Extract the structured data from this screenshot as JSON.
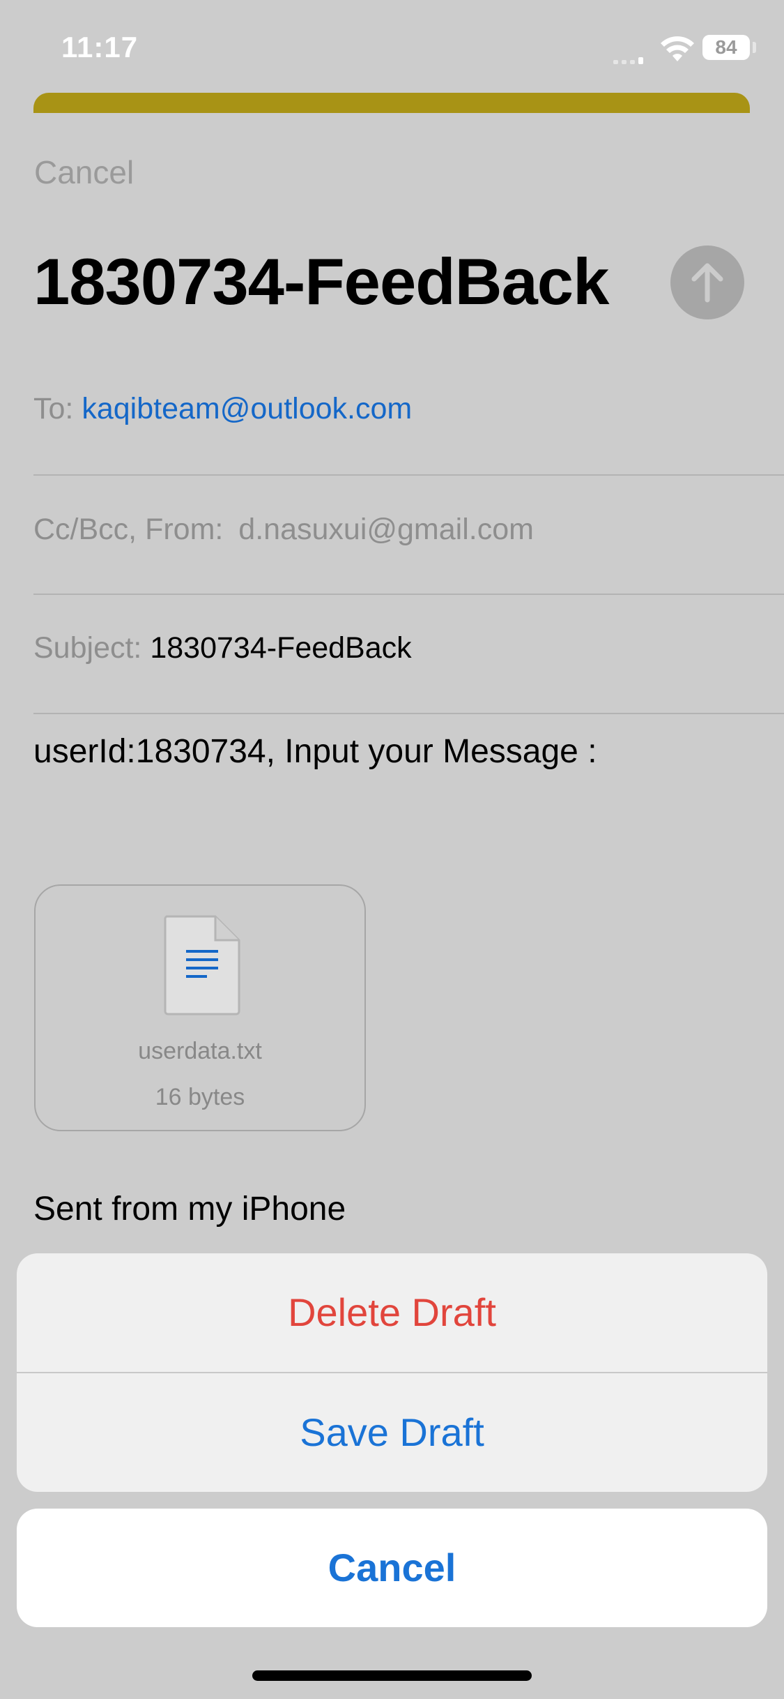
{
  "status_bar": {
    "time": "11:17",
    "battery": "84",
    "icons": [
      "signal-icon",
      "wifi-icon",
      "battery-icon"
    ]
  },
  "compose": {
    "cancel_label": "Cancel",
    "title": "1830734-FeedBack",
    "send_icon": "arrow-up-icon",
    "to_label": "To:",
    "to_value": "kaqibteam@outlook.com",
    "cc_label": "Cc/Bcc, From:",
    "from_value": "d.nasuxui@gmail.com",
    "subject_label": "Subject:",
    "subject_value": "1830734-FeedBack",
    "body": "userId:1830734, Input your Message :",
    "attachment": {
      "icon": "text-document-icon",
      "name": "userdata.txt",
      "size": "16 bytes"
    },
    "signature": "Sent from my iPhone"
  },
  "action_sheet": {
    "delete_label": "Delete Draft",
    "save_label": "Save Draft",
    "cancel_label": "Cancel"
  },
  "colors": {
    "link_blue": "#1467c8",
    "action_blue": "#1a73d6",
    "destructive_red": "#e1453c",
    "banner_yellow": "#a89315",
    "dim_background": "#cccccc"
  }
}
